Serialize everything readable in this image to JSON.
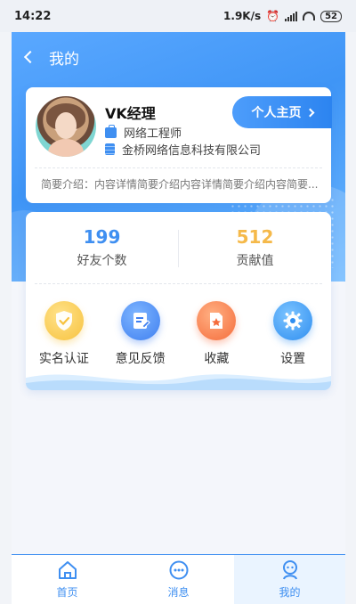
{
  "status_bar": {
    "time": "14:22",
    "speed": "1.9K/s",
    "battery": "52"
  },
  "navbar": {
    "title": "我的"
  },
  "profile": {
    "name": "VK经理",
    "job": "网络工程师",
    "company": "金桥网络信息科技有限公司",
    "home_button": "个人主页",
    "intro": "简要介绍：内容详情简要介绍内容详情简要介绍内容简要..."
  },
  "stats": {
    "friends": {
      "value": "199",
      "label": "好友个数"
    },
    "contribution": {
      "value": "512",
      "label": "贡献值"
    }
  },
  "actions": [
    {
      "label": "实名认证",
      "icon": "shield-check-icon",
      "color": "#f7c23e"
    },
    {
      "label": "意见反馈",
      "icon": "edit-doc-icon",
      "color": "#3f7ff0"
    },
    {
      "label": "收藏",
      "icon": "star-doc-icon",
      "color": "#f56c3b"
    },
    {
      "label": "设置",
      "icon": "gear-icon",
      "color": "#2f8ef0"
    }
  ],
  "tabbar": [
    {
      "label": "首页",
      "icon": "home-icon"
    },
    {
      "label": "消息",
      "icon": "message-icon"
    },
    {
      "label": "我的",
      "icon": "user-icon",
      "active": true
    }
  ],
  "colors": {
    "primary": "#3f8ff1",
    "accent": "#f5b94a"
  }
}
